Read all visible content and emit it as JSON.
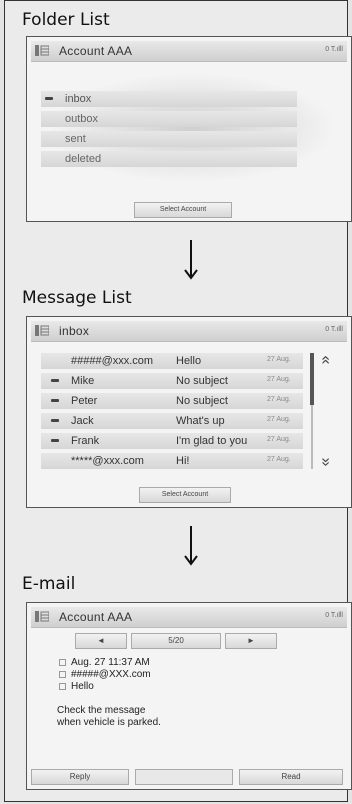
{
  "sections": {
    "folder_list": "Folder List",
    "message_list": "Message List",
    "email": "E-mail"
  },
  "folder_screen": {
    "title": "Account AAA",
    "status": "0 T.ılll",
    "folders": [
      {
        "label": "inbox"
      },
      {
        "label": "outbox"
      },
      {
        "label": "sent"
      },
      {
        "label": "deleted"
      }
    ],
    "select_account": "Select Account"
  },
  "message_screen": {
    "title": "inbox",
    "status": "0 T.ılll",
    "messages": [
      {
        "from": "#####@xxx.com",
        "subject": "Hello",
        "date": "27 Aug."
      },
      {
        "from": "Mike",
        "subject": "No subject",
        "date": "27 Aug."
      },
      {
        "from": "Peter",
        "subject": "No subject",
        "date": "27 Aug."
      },
      {
        "from": "Jack",
        "subject": "What's up",
        "date": "27 Aug."
      },
      {
        "from": "Frank",
        "subject": "I'm glad to you",
        "date": "27 Aug."
      },
      {
        "from": "*****@xxx.com",
        "subject": "Hi!",
        "date": "27 Aug."
      }
    ],
    "select_account": "Select Account",
    "scroll_up": "«",
    "scroll_down": "»"
  },
  "email_screen": {
    "title": "Account AAA",
    "status": "0 T.ılll",
    "pager": "5/20",
    "prev": "◄",
    "next": "►",
    "date": "Aug. 27 11:37 AM",
    "from": "#####@XXX.com",
    "subject": "Hello",
    "body_line1": "Check the message",
    "body_line2": "when vehicle is parked.",
    "reply": "Reply",
    "middle": "",
    "read": "Read"
  }
}
